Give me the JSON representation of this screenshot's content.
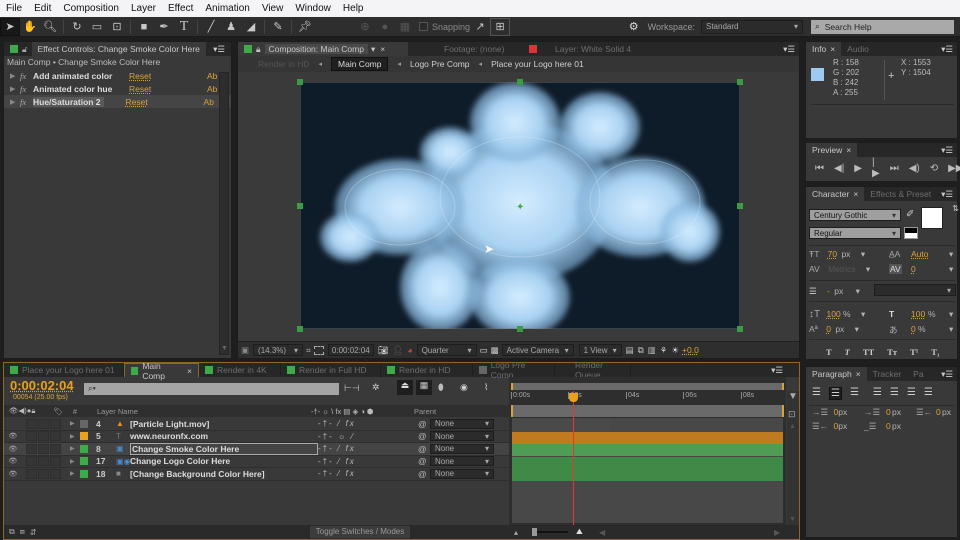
{
  "menu": [
    "File",
    "Edit",
    "Composition",
    "Layer",
    "Effect",
    "Animation",
    "View",
    "Window",
    "Help"
  ],
  "toolbar": {
    "tools": [
      "selection-tool",
      "hand-tool",
      "zoom-tool",
      "rotate-tool",
      "camera-tool",
      "pan-behind-tool",
      "rectangle-tool",
      "pen-tool",
      "type-tool",
      "brush-tool",
      "clone-stamp-tool",
      "eraser-tool",
      "roto-brush-tool",
      "puppet-pin-tool"
    ],
    "snapping_label": "Snapping",
    "workspace_label": "Workspace:",
    "workspace_value": "Standard",
    "search_placeholder": "Search Help"
  },
  "effect_controls": {
    "tab_label": "Effect Controls: Change Smoke Color Here",
    "breadcrumb": "Main Comp • Change Smoke Color Here",
    "effects": [
      {
        "name": "Add animated color",
        "reset": "Reset",
        "about": "Ab"
      },
      {
        "name": "Animated color hue",
        "reset": "Reset",
        "about": "Ab"
      },
      {
        "name": "Hue/Saturation 2",
        "reset": "Reset",
        "about": "Ab"
      }
    ]
  },
  "composition": {
    "tabs": [
      {
        "label": "Composition: Main Comp",
        "color": "#3faa4a"
      },
      {
        "label": "Footage: (none)"
      },
      {
        "label": "Layer: White Solid 4",
        "color": "#d23a3a"
      }
    ],
    "flow": [
      "Render in HD",
      "Main Comp",
      "Logo Pre Comp",
      "Place your Logo here 01"
    ],
    "footer": {
      "zoom": "(14.3%)",
      "timecode": "0:00:02:04",
      "resolution": "Quarter",
      "camera": "Active Camera",
      "view": "1 View",
      "exposure": "+0.0"
    }
  },
  "info": {
    "tabs": [
      "Info",
      "Audio"
    ],
    "swatch": "#9ecaf2",
    "r": "R : 158",
    "g": "G : 202",
    "b": "B : 242",
    "a": "A : 255",
    "x": "X : 1553",
    "y": "Y : 1504"
  },
  "preview": {
    "tab": "Preview"
  },
  "character": {
    "tabs": [
      "Character",
      "Effects & Preset"
    ],
    "font": "Century Gothic",
    "style": "Regular",
    "size": "70",
    "size_unit": "px",
    "leading": "Auto",
    "kerning": "Metrics",
    "tracking": "0",
    "stroke": "-",
    "stroke_unit": "px",
    "vscale": "100",
    "hscale": "100",
    "pct": "%",
    "baseline": "0",
    "baseline_unit": "px",
    "tsume": "0",
    "tsume_unit": "%"
  },
  "paragraph": {
    "tabs": [
      "Paragraph",
      "Tracker",
      "Pa"
    ],
    "indents": [
      {
        "value": "0",
        "unit": "px"
      },
      {
        "value": "0",
        "unit": "px"
      },
      {
        "value": "0",
        "unit": "px"
      },
      {
        "value": "0",
        "unit": "px"
      },
      {
        "value": "0",
        "unit": "px"
      }
    ]
  },
  "timeline": {
    "tabs": [
      {
        "label": "Place your Logo here 01",
        "color": "#3faa4a"
      },
      {
        "label": "Main Comp",
        "color": "#3faa4a",
        "active": true
      },
      {
        "label": "Render in 4K",
        "color": "#3faa4a"
      },
      {
        "label": "Render in Full HD",
        "color": "#3faa4a"
      },
      {
        "label": "Render in HD",
        "color": "#3faa4a"
      },
      {
        "label": "Logo Pre Comp",
        "color": "#666666"
      },
      {
        "label": "Render Queue"
      }
    ],
    "timecode": "0:00:02:04",
    "frame_info": "00054 (25.00 fps)",
    "search_placeholder": "",
    "columns": {
      "num": "#",
      "layer_name": "Layer Name",
      "parent": "Parent"
    },
    "ruler": [
      "0:00s",
      "02s",
      "04s",
      "06s",
      "08s"
    ],
    "playhead_seconds": 2.16,
    "duration_seconds": 9.5,
    "layers": [
      {
        "num": "4",
        "name": "[Particle Light.mov]",
        "label": "#666666",
        "parent": "None",
        "visible": false,
        "type": "footage",
        "bar": "#4a4a4a",
        "bar_end": 0.36
      },
      {
        "num": "5",
        "name": "www.neuronfx.com",
        "label": "#e8a020",
        "parent": "None",
        "visible": true,
        "type": "text",
        "bar": "#c07a20",
        "bar_end": 1.0
      },
      {
        "num": "8",
        "name": "Change Smoke Color Here",
        "label": "#3faa4a",
        "parent": "None",
        "visible": true,
        "type": "adjust",
        "bar": "#4f9c55",
        "bar_end": 1.0,
        "selected": true
      },
      {
        "num": "17",
        "name": "Change Logo Color Here",
        "label": "#3faa4a",
        "parent": "None",
        "visible": true,
        "type": "comp",
        "bar": "#3f8a47",
        "bar_end": 1.0
      },
      {
        "num": "18",
        "name": "[Change Background Color Here]",
        "label": "#3faa4a",
        "parent": "None",
        "visible": true,
        "type": "solid",
        "bar": "#3f8a47",
        "bar_end": 1.0
      }
    ],
    "toggle_label": "Toggle Switches / Modes"
  }
}
